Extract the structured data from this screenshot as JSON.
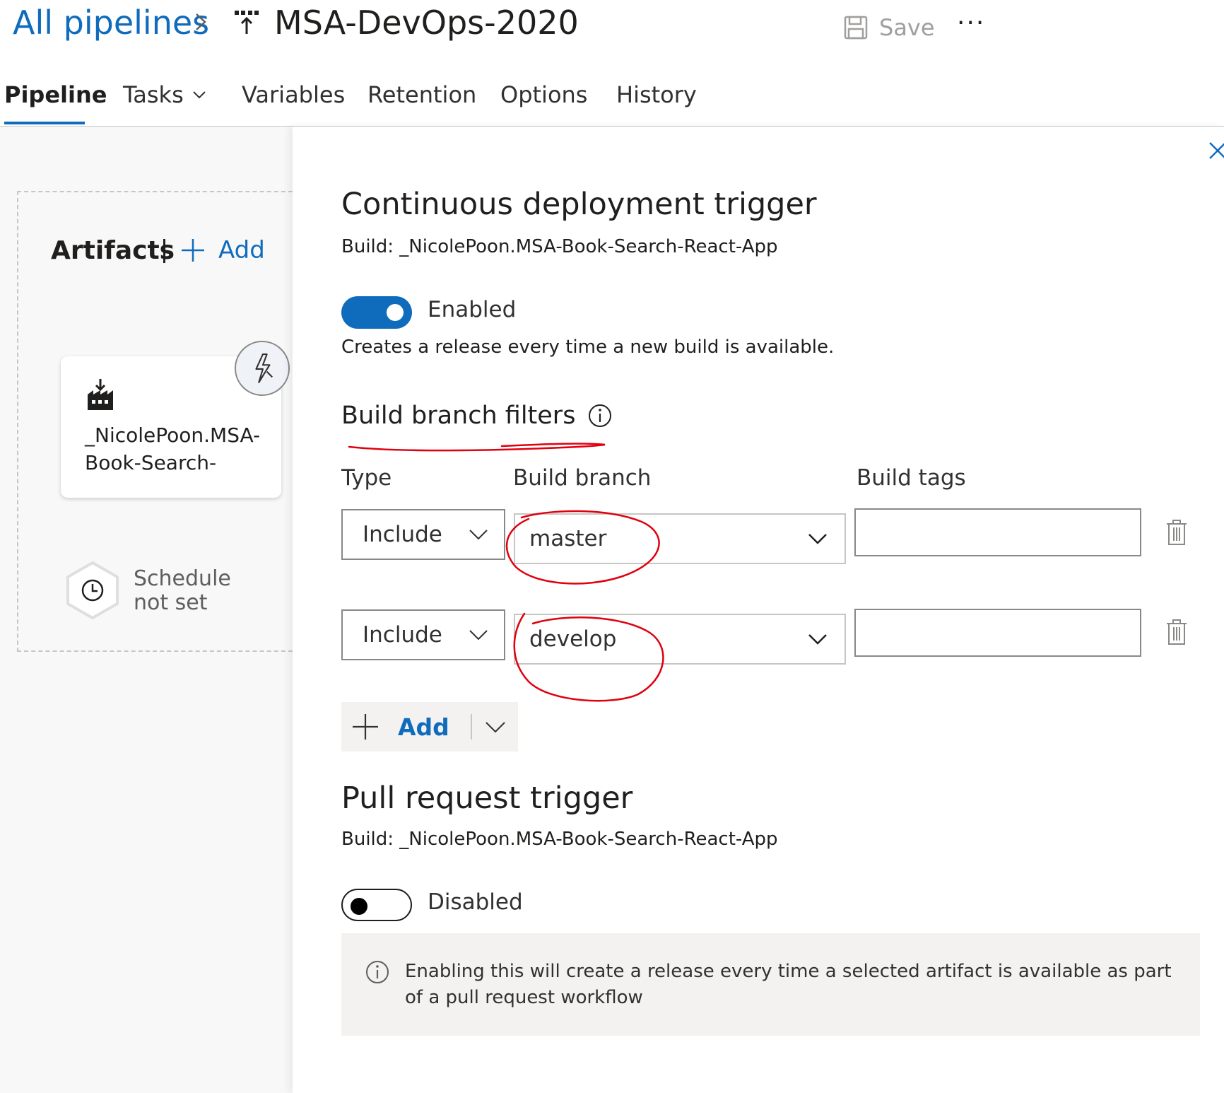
{
  "header": {
    "breadcrumb": "All pipelines",
    "title": "MSA-DevOps-2020",
    "save_label": "Save",
    "more_label": "···"
  },
  "tabs": [
    {
      "label": "Pipeline",
      "active": true
    },
    {
      "label": "Tasks"
    },
    {
      "label": "Variables"
    },
    {
      "label": "Retention"
    },
    {
      "label": "Options"
    },
    {
      "label": "History"
    }
  ],
  "artifacts": {
    "label": "Artifacts",
    "add_label": "Add",
    "card_name": "_NicolePoon.MSA-Book-Search-",
    "schedule_label": "Schedule not set"
  },
  "cd_trigger": {
    "title": "Continuous deployment trigger",
    "source": "Build: _NicolePoon.MSA-Book-Search-React-App",
    "toggle_label": "Enabled",
    "enabled": true,
    "description": "Creates a release every time a new build is available.",
    "filters_heading": "Build branch filters",
    "columns": {
      "type": "Type",
      "branch": "Build branch",
      "tags": "Build tags"
    },
    "filters": [
      {
        "type": "Include",
        "branch": "master",
        "tags": ""
      },
      {
        "type": "Include",
        "branch": "develop",
        "tags": ""
      }
    ],
    "add_label": "Add"
  },
  "pr_trigger": {
    "title": "Pull request trigger",
    "source": "Build: _NicolePoon.MSA-Book-Search-React-App",
    "toggle_label": "Disabled",
    "enabled": false,
    "info": "Enabling this will create a release every time a selected artifact is available as part of a pull request workflow"
  },
  "colors": {
    "accent": "#0f6cbd",
    "annotation": "#e0000f"
  },
  "icons": [
    "chevron-right-icon",
    "release-pipeline-icon",
    "save-icon",
    "more-icon",
    "chevron-down-icon",
    "plus-icon",
    "build-artifact-icon",
    "lightning-icon",
    "clock-icon",
    "close-icon",
    "info-icon",
    "trash-icon"
  ]
}
